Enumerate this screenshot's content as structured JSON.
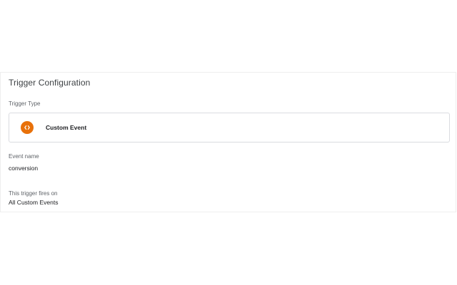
{
  "card": {
    "title": "Trigger Configuration"
  },
  "trigger_type": {
    "label": "Trigger Type",
    "name": "Custom Event",
    "icon": "custom-event-icon",
    "icon_color": "#e8710a"
  },
  "event_name": {
    "label": "Event name",
    "value": "conversion"
  },
  "fires_on": {
    "label": "This trigger fires on",
    "value": "All Custom Events"
  }
}
